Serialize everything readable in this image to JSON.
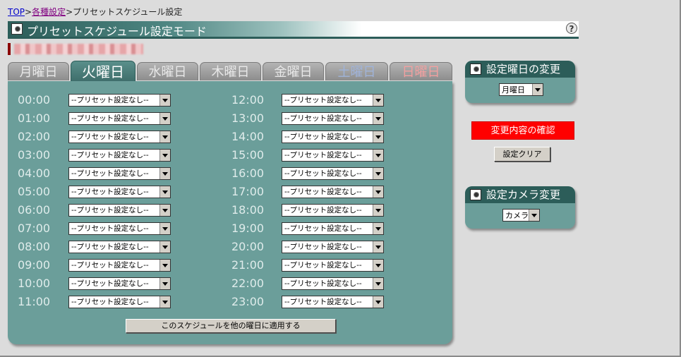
{
  "breadcrumb": {
    "top": "TOP",
    "sep1": ">",
    "settings": "各種設定",
    "sep2": ">",
    "current": "プリセットスケジュール設定"
  },
  "title": {
    "text": "プリセットスケジュール設定モード",
    "help": "?"
  },
  "camera_name": "(redacted)",
  "tabs": [
    {
      "label": "月曜日",
      "active": false
    },
    {
      "label": "火曜日",
      "active": true
    },
    {
      "label": "水曜日",
      "active": false
    },
    {
      "label": "木曜日",
      "active": false
    },
    {
      "label": "金曜日",
      "active": false
    },
    {
      "label": "土曜日",
      "active": false
    },
    {
      "label": "日曜日",
      "active": false
    }
  ],
  "schedule": {
    "left": [
      {
        "time": "00:00",
        "value": "--プリセット設定なし--"
      },
      {
        "time": "01:00",
        "value": "--プリセット設定なし--"
      },
      {
        "time": "02:00",
        "value": "--プリセット設定なし--"
      },
      {
        "time": "03:00",
        "value": "--プリセット設定なし--"
      },
      {
        "time": "04:00",
        "value": "--プリセット設定なし--"
      },
      {
        "time": "05:00",
        "value": "--プリセット設定なし--"
      },
      {
        "time": "06:00",
        "value": "--プリセット設定なし--"
      },
      {
        "time": "07:00",
        "value": "--プリセット設定なし--"
      },
      {
        "time": "08:00",
        "value": "--プリセット設定なし--"
      },
      {
        "time": "09:00",
        "value": "--プリセット設定なし--"
      },
      {
        "time": "10:00",
        "value": "--プリセット設定なし--"
      },
      {
        "time": "11:00",
        "value": "--プリセット設定なし--"
      }
    ],
    "right": [
      {
        "time": "12:00",
        "value": "--プリセット設定なし--"
      },
      {
        "time": "13:00",
        "value": "--プリセット設定なし--"
      },
      {
        "time": "14:00",
        "value": "--プリセット設定なし--"
      },
      {
        "time": "15:00",
        "value": "--プリセット設定なし--"
      },
      {
        "time": "16:00",
        "value": "--プリセット設定なし--"
      },
      {
        "time": "17:00",
        "value": "--プリセット設定なし--"
      },
      {
        "time": "18:00",
        "value": "--プリセット設定なし--"
      },
      {
        "time": "19:00",
        "value": "--プリセット設定なし--"
      },
      {
        "time": "20:00",
        "value": "--プリセット設定なし--"
      },
      {
        "time": "21:00",
        "value": "--プリセット設定なし--"
      },
      {
        "time": "22:00",
        "value": "--プリセット設定なし--"
      },
      {
        "time": "23:00",
        "value": "--プリセット設定なし--"
      }
    ],
    "apply_label": "このスケジュールを他の曜日に適用する"
  },
  "day_change": {
    "header": "設定曜日の変更",
    "selected": "月曜日"
  },
  "confirm_label": "変更内容の確認",
  "clear_label": "設定クリア",
  "camera_change": {
    "header": "設定カメラ変更",
    "selected": "カメラ"
  },
  "colors": {
    "panel": "#6b9e9a",
    "header_dark": "#2c5d59",
    "confirm_red": "#ff0000",
    "saturday": "#9fb3d9",
    "sunday": "#f2a0a0"
  }
}
